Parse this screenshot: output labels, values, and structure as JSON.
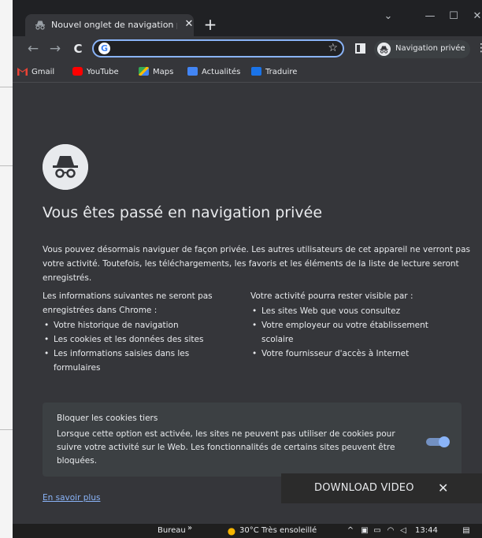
{
  "browser": {
    "tab": {
      "title": "Nouvel onglet de navigation privée"
    },
    "new_tab_symbol": "+",
    "window_controls": {
      "menu": "⌄",
      "minimize": "—",
      "maximize": "☐",
      "close": "✕"
    },
    "toolbar": {
      "back": "←",
      "forward": "→",
      "reload": "C",
      "omnibox_value": "",
      "omnibox_placeholder": "",
      "incognito_label": "Navigation privée"
    },
    "bookmarks": [
      {
        "label": "Gmail",
        "icon": "gmail-icon",
        "color": "#ea4335"
      },
      {
        "label": "YouTube",
        "icon": "youtube-icon",
        "color": "#ff0000"
      },
      {
        "label": "Maps",
        "icon": "maps-icon",
        "color": "#34a853"
      },
      {
        "label": "Actualités",
        "icon": "news-icon",
        "color": "#4285f4"
      },
      {
        "label": "Traduire",
        "icon": "translate-icon",
        "color": "#1a73e8"
      }
    ]
  },
  "page": {
    "headline": "Vous êtes passé en navigation privée",
    "intro": "Vous pouvez désormais naviguer de façon privée. Les autres utilisateurs de cet appareil ne verront pas votre activité. Toutefois, les téléchargements, les favoris et les éléments de la liste de lecture seront enregistrés.",
    "not_saved": {
      "title": "Les informations suivantes ne seront pas enregistrées dans Chrome :",
      "items": [
        "Votre historique de navigation",
        "Les cookies et les données des sites",
        "Les informations saisies dans les formulaires"
      ]
    },
    "visible_to": {
      "title": "Votre activité pourra rester visible par :",
      "items": [
        "Les sites Web que vous consultez",
        "Votre employeur ou votre établissement scolaire",
        "Votre fournisseur d'accès à Internet"
      ]
    },
    "cookies": {
      "title": "Bloquer les cookies tiers",
      "description": "Lorsque cette option est activée, les sites ne peuvent pas utiliser de cookies pour suivre votre activité sur le Web. Les fonctionnalités de certains sites peuvent être bloquées.",
      "enabled": true
    },
    "learn_more": "En savoir plus"
  },
  "overlay": {
    "download_label": "DOWNLOAD VIDEO",
    "close_symbol": "✕"
  },
  "taskbar": {
    "desktop_label": "Bureau",
    "chevron": "»",
    "weather": "30°C  Très ensoleillé",
    "time": "13:44"
  },
  "colors": {
    "accent": "#8ab4f8",
    "frame": "#202124",
    "surface": "#35363a",
    "card": "#3c4043",
    "text": "#e8eaed"
  }
}
